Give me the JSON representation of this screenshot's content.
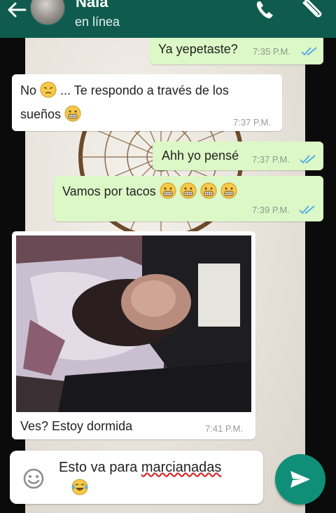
{
  "header": {
    "contact_name": "Naia",
    "status": "en línea",
    "back_icon": "arrow-left-icon",
    "call_icon": "phone-icon",
    "attach_icon": "paperclip-icon",
    "background_color": "#0f5c4f"
  },
  "messages": [
    {
      "direction": "out",
      "text": "Ya yepetaste?",
      "time": "7:35 P.M.",
      "read": true
    },
    {
      "direction": "in",
      "text_before_emoji": "No",
      "text_after_emoji": "... Te respondo a través de los",
      "line2": "sueños",
      "time": "7:37 P.M."
    },
    {
      "direction": "out",
      "text": "Ahh yo pensé",
      "time": "7:37 P.M.",
      "read": true
    },
    {
      "direction": "out",
      "text": "Vamos por tacos",
      "emoji_count": 4,
      "time": "7:39 P.M.",
      "read": true
    },
    {
      "direction": "in",
      "type": "image",
      "image_desc": "photo-person-sleeping",
      "caption": "Ves? Estoy dormida",
      "time": "7:41 P.M."
    }
  ],
  "composer": {
    "text_before": "Esto va para",
    "misspelled_word": "marcianadas",
    "emoji_icon": "smiley-face-icon",
    "send_icon": "send-arrow-icon",
    "send_color": "#0f8f77"
  }
}
